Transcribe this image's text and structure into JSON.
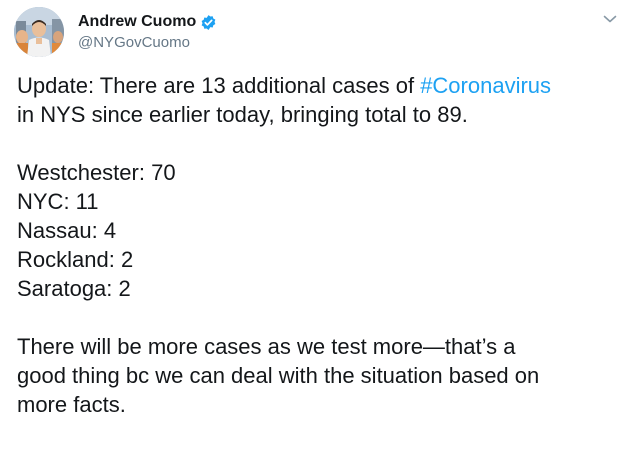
{
  "author": {
    "display_name": "Andrew Cuomo",
    "handle": "@NYGovCuomo",
    "verified": true,
    "avatar_icon": "profile-photo"
  },
  "menu_icon": "chevron-down-icon",
  "tweet": {
    "intro_prefix": "Update: There are 13 additional cases of ",
    "hashtag": "#Coronavirus",
    "intro_line2": " in NYS since earlier today, bringing total to 89.",
    "counties": [
      "Westchester: 70",
      "NYC: 11",
      "Nassau: 4",
      "Rockland: 2",
      "Saratoga: 2"
    ],
    "closing_lines": [
      "There will be more cases as we test more—that’s a",
      "good thing bc we can deal with the situation based on",
      "more facts."
    ]
  },
  "colors": {
    "text": "#14171a",
    "secondary": "#657786",
    "link": "#1da1f2",
    "verified_badge": "#1da1f2"
  }
}
